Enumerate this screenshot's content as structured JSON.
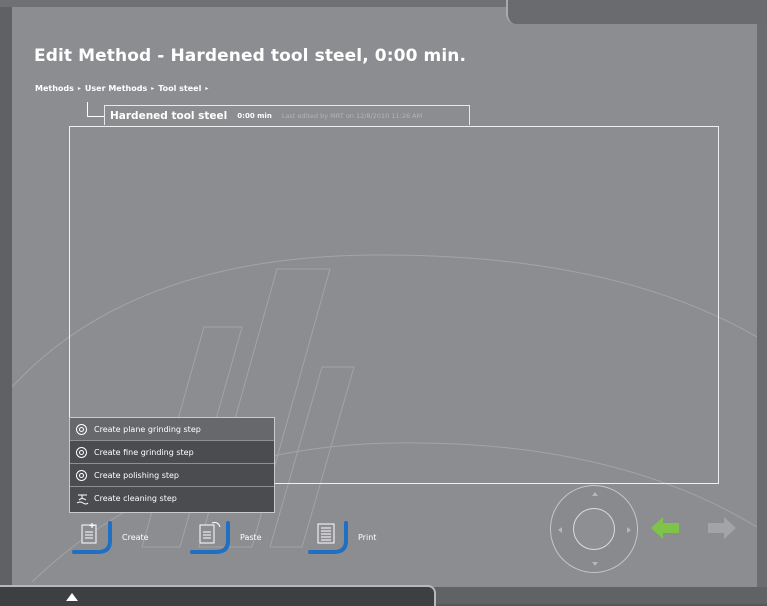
{
  "header": {
    "title": "Edit Method - Hardened tool steel, 0:00 min."
  },
  "breadcrumb": {
    "items": [
      "Methods",
      "User Methods",
      "Tool steel"
    ],
    "separator": "▸"
  },
  "method": {
    "name": "Hardened tool steel",
    "duration": "0:00 min",
    "last_edited": "Last edited by MRT on 12/8/2010 11:26 AM"
  },
  "create_menu": {
    "items": [
      {
        "label": "Create plane grinding step",
        "icon": "step-circle-icon"
      },
      {
        "label": "Create fine grinding step",
        "icon": "step-circle-icon"
      },
      {
        "label": "Create polishing step",
        "icon": "step-circle-icon"
      },
      {
        "label": "Create cleaning step",
        "icon": "cleaning-icon"
      }
    ]
  },
  "toolbar": {
    "create_label": "Create",
    "paste_label": "Paste",
    "print_label": "Print"
  },
  "colors": {
    "background": "#8c8d90",
    "accent_blue": "#1f6fc2",
    "back_arrow_green": "#7fc34a",
    "menu_bg": "#4a4c50"
  }
}
